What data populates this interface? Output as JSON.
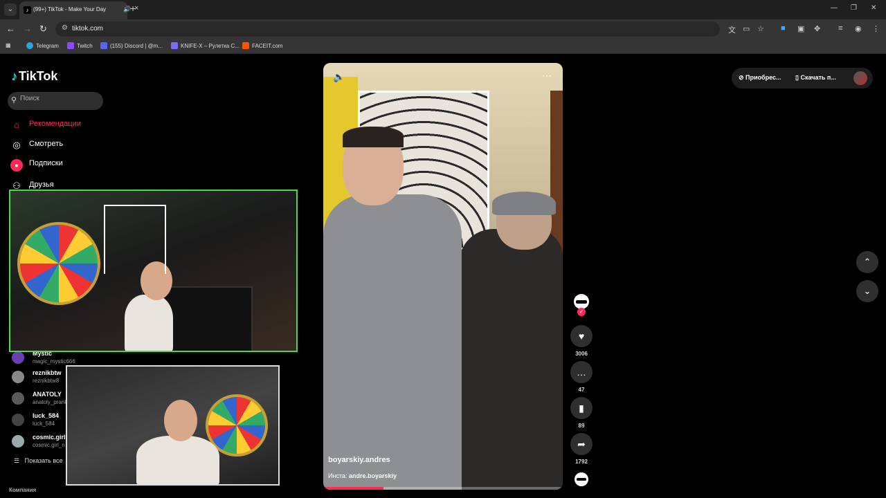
{
  "browser": {
    "tab_title": "(99+) TikTok - Make Your Day",
    "tab_sound_icon": "speaker-icon",
    "url": "tiktok.com",
    "new_tab": "+",
    "bookmarks": [
      {
        "label": "Telegram",
        "color": "#2aa3df"
      },
      {
        "label": "Twitch",
        "color": "#9146ff"
      },
      {
        "label": "(155) Discord | @m...",
        "color": "#5865f2"
      },
      {
        "label": "KNIFE-X – Рулетка С...",
        "color": "#7a6cff"
      },
      {
        "label": "FACEIT.com",
        "color": "#ff5500"
      }
    ]
  },
  "sidebar": {
    "logo": "TikTok",
    "search_placeholder": "Поиск",
    "nav": [
      {
        "label": "Рекомендации",
        "icon": "home-icon",
        "active": true
      },
      {
        "label": "Смотреть",
        "icon": "compass-icon"
      },
      {
        "label": "Подписки",
        "icon": "following-icon"
      },
      {
        "label": "Друзья",
        "icon": "friends-icon"
      }
    ],
    "following": [
      {
        "name": "Mystic",
        "handle": "magic_mystic666"
      },
      {
        "name": "reznikbtw",
        "handle": "reznikbtw8"
      },
      {
        "name": "ANATOLY",
        "handle": "anatoly_prank"
      },
      {
        "name": "luck_584",
        "handle": "luck_584"
      },
      {
        "name": "cosmic.girl",
        "handle": "cosmic.girl_n"
      }
    ],
    "show_more": "Показать все",
    "footer": "Компания"
  },
  "video": {
    "author": "boyarskiy.andres",
    "desc_prefix": "Инста: ",
    "desc_link": "andre.boyarskiy",
    "progress": 0.25,
    "likes": "3006",
    "comments": "47",
    "saves": "89",
    "shares": "1792"
  },
  "header": {
    "coins_label": "Приобрес...",
    "download_label": "Скачать п..."
  },
  "colors": {
    "accent": "#fe2c55",
    "overlay_border": "#4cd94c"
  }
}
